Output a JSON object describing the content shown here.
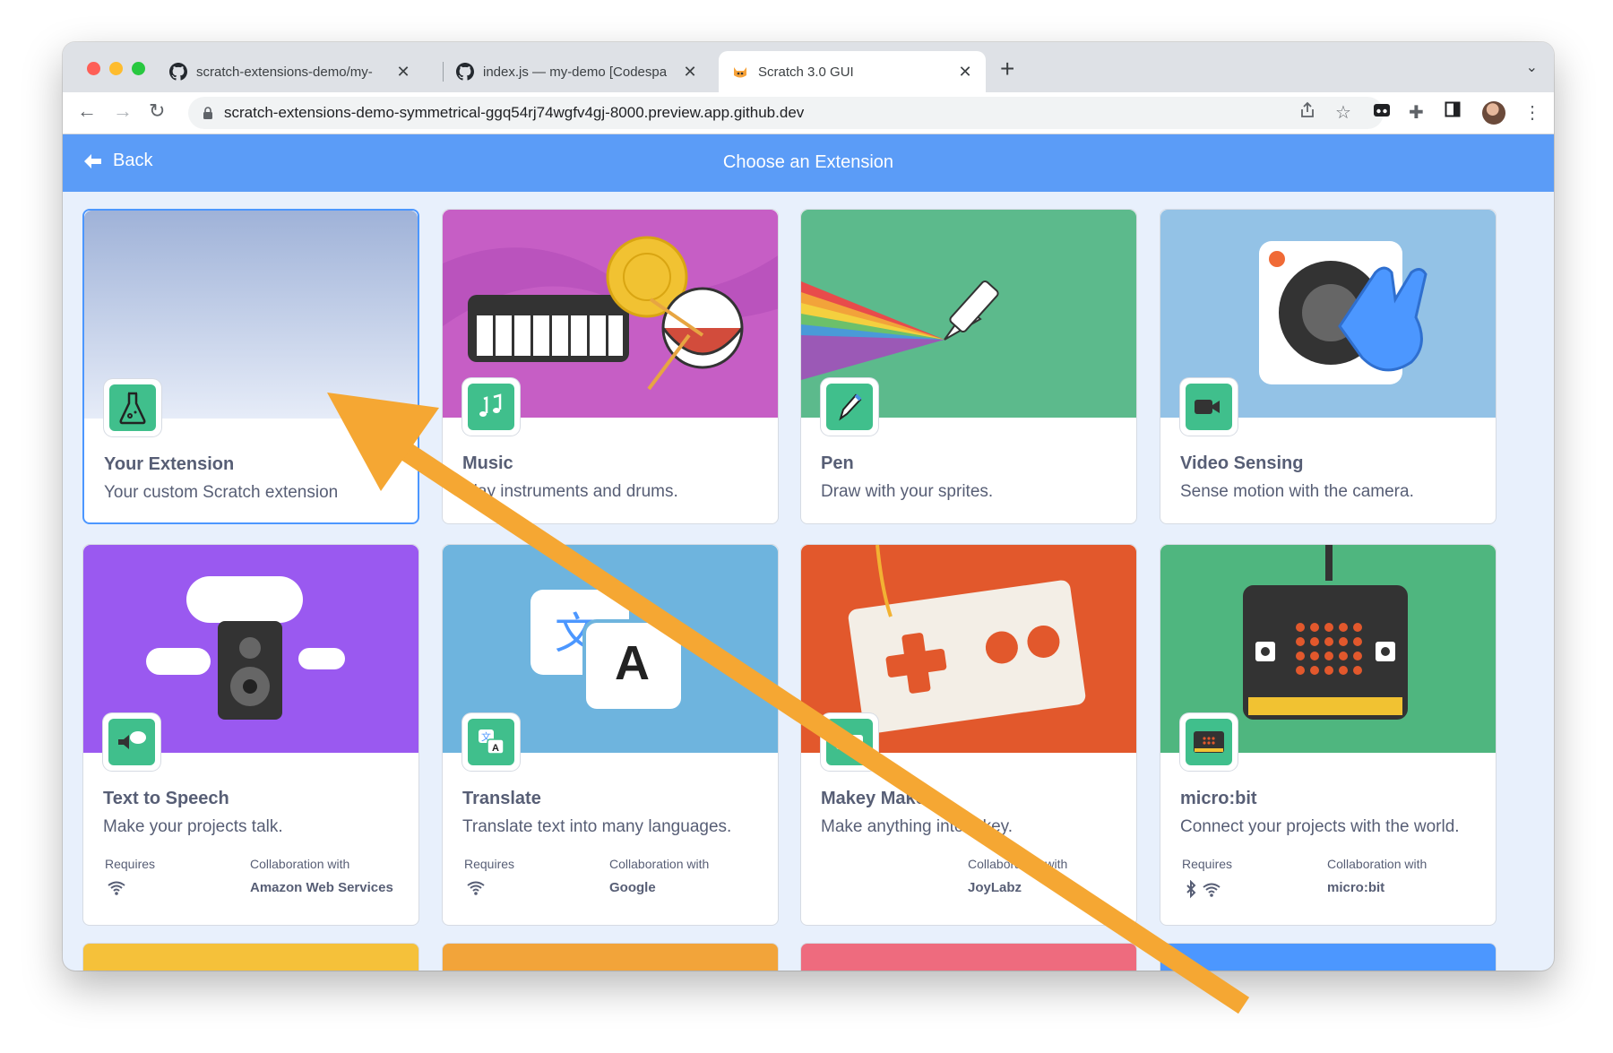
{
  "browser": {
    "tabs": [
      {
        "label": "scratch-extensions-demo/my-",
        "icon": "github-icon"
      },
      {
        "label": "index.js — my-demo [Codespa",
        "icon": "github-icon"
      },
      {
        "label": "Scratch 3.0 GUI",
        "icon": "scratch-cat-icon"
      }
    ],
    "url": "scratch-extensions-demo-symmetrical-ggq54rj74wgfv4gj-8000.preview.app.github.dev"
  },
  "header": {
    "back_label": "Back",
    "title": "Choose an Extension",
    "color": "#5b9cf7"
  },
  "extensions": [
    {
      "name": "Your Extension",
      "description": "Your custom Scratch extension",
      "requires_label": "",
      "collab_label": "",
      "collab": ""
    },
    {
      "name": "Music",
      "description": "Play instruments and drums.",
      "requires_label": "",
      "collab_label": "",
      "collab": ""
    },
    {
      "name": "Pen",
      "description": "Draw with your sprites.",
      "requires_label": "",
      "collab_label": "",
      "collab": ""
    },
    {
      "name": "Video Sensing",
      "description": "Sense motion with the camera.",
      "requires_label": "",
      "collab_label": "",
      "collab": ""
    },
    {
      "name": "Text to Speech",
      "description": "Make your projects talk.",
      "requires_label": "Requires",
      "collab_label": "Collaboration with",
      "collab": "Amazon Web Services"
    },
    {
      "name": "Translate",
      "description": "Translate text into many languages.",
      "requires_label": "Requires",
      "collab_label": "Collaboration with",
      "collab": "Google"
    },
    {
      "name": "Makey Makey",
      "description": "Make anything into a key.",
      "requires_label": "",
      "collab_label": "Collaboration with",
      "collab": "JoyLabz"
    },
    {
      "name": "micro:bit",
      "description": "Connect your projects with the world.",
      "requires_label": "Requires",
      "collab_label": "Collaboration with",
      "collab": "micro:bit"
    }
  ],
  "annotation": {
    "color": "#f5a733"
  }
}
